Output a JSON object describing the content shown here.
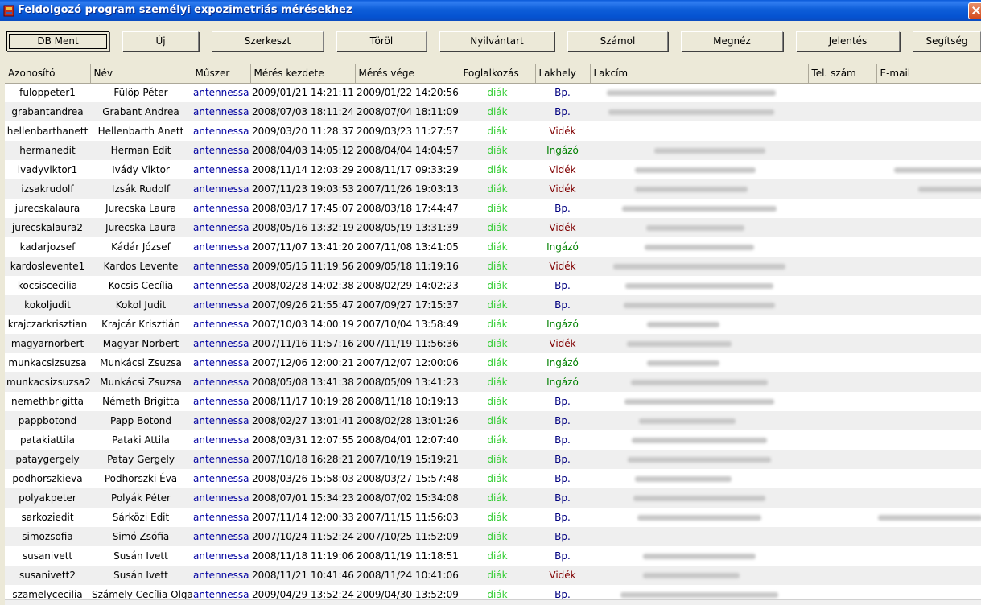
{
  "window": {
    "title": "Feldolgozó program személyi expozimetriás mérésekhez"
  },
  "toolbar": {
    "buttons": [
      "DB Ment",
      "Új",
      "Szerkeszt",
      "Töröl",
      "Nyilvántart",
      "Számol",
      "Megnéz",
      "Jelentés",
      "Segítség"
    ]
  },
  "table": {
    "headers": [
      "Azonosító",
      "Név",
      "Műszer",
      "Mérés kezdete",
      "Mérés vége",
      "Foglalkozás",
      "Lakhely",
      "Lakcím",
      "Tel. szám",
      "E-mail"
    ],
    "rows": [
      [
        "fuloppeter1",
        "Fülöp Péter",
        "antennessa",
        "2009/01/21 14:21:11",
        "2009/01/22 14:20:56",
        "diák",
        "Bp."
      ],
      [
        "grabantandrea",
        "Grabant Andrea",
        "antennessa",
        "2008/07/03 18:11:24",
        "2008/07/04 18:11:09",
        "diák",
        "Bp."
      ],
      [
        "hellenbarthanett",
        "Hellenbarth Anett",
        "antennessa",
        "2009/03/20 11:28:37",
        "2009/03/23 11:27:57",
        "diák",
        "Vidék"
      ],
      [
        "hermanedit",
        "Herman Edit",
        "antennessa",
        "2008/04/03 14:05:12",
        "2008/04/04 14:04:57",
        "diák",
        "Ingázó"
      ],
      [
        "ivadyviktor1",
        "Ivády Viktor",
        "antennessa",
        "2008/11/14 12:03:29",
        "2008/11/17 09:33:29",
        "diák",
        "Vidék"
      ],
      [
        "izsakrudolf",
        "Izsák Rudolf",
        "antennessa",
        "2007/11/23 19:03:53",
        "2007/11/26 19:03:13",
        "diák",
        "Vidék"
      ],
      [
        "jurecskalaura",
        "Jurecska Laura",
        "antennessa",
        "2008/03/17 17:45:07",
        "2008/03/18 17:44:47",
        "diák",
        "Bp."
      ],
      [
        "jurecskalaura2",
        "Jurecska Laura",
        "antennessa",
        "2008/05/16 13:32:19",
        "2008/05/19 13:31:39",
        "diák",
        "Vidék"
      ],
      [
        "kadarjozsef",
        "Kádár József",
        "antennessa",
        "2007/11/07 13:41:20",
        "2007/11/08 13:41:05",
        "diák",
        "Ingázó"
      ],
      [
        "kardoslevente1",
        "Kardos Levente",
        "antennessa",
        "2009/05/15 11:19:56",
        "2009/05/18 11:19:16",
        "diák",
        "Vidék"
      ],
      [
        "kocsiscecilia",
        "Kocsis Cecília",
        "antennessa",
        "2008/02/28 14:02:38",
        "2008/02/29 14:02:23",
        "diák",
        "Bp."
      ],
      [
        "kokoljudit",
        "Kokol Judit",
        "antennessa",
        "2007/09/26 21:55:47",
        "2007/09/27 17:15:37",
        "diák",
        "Bp."
      ],
      [
        "krajczarkrisztian",
        "Krajcár Krisztián",
        "antennessa",
        "2007/10/03 14:00:19",
        "2007/10/04 13:58:49",
        "diák",
        "Ingázó"
      ],
      [
        "magyarnorbert",
        "Magyar Norbert",
        "antennessa",
        "2007/11/16 11:57:16",
        "2007/11/19 11:56:36",
        "diák",
        "Vidék"
      ],
      [
        "munkacsizsuzsa",
        "Munkácsi Zsuzsa",
        "antennessa",
        "2007/12/06 12:00:21",
        "2007/12/07 12:00:06",
        "diák",
        "Ingázó"
      ],
      [
        "munkacsizsuzsa2",
        "Munkácsi Zsuzsa",
        "antennessa",
        "2008/05/08 13:41:38",
        "2008/05/09 13:41:23",
        "diák",
        "Ingázó"
      ],
      [
        "nemethbrigitta",
        "Németh Brigitta",
        "antennessa",
        "2008/11/17 10:19:28",
        "2008/11/18 10:19:13",
        "diák",
        "Bp."
      ],
      [
        "pappbotond",
        "Papp Botond",
        "antennessa",
        "2008/02/27 13:01:41",
        "2008/02/28 13:01:26",
        "diák",
        "Bp."
      ],
      [
        "patakiattila",
        "Pataki Attila",
        "antennessa",
        "2008/03/31 12:07:55",
        "2008/04/01 12:07:40",
        "diák",
        "Bp."
      ],
      [
        "pataygergely",
        "Patay Gergely",
        "antennessa",
        "2007/10/18 16:28:21",
        "2007/10/19 15:19:21",
        "diák",
        "Bp."
      ],
      [
        "podhorszkieva",
        "Podhorszki Éva",
        "antennessa",
        "2008/03/26 15:58:03",
        "2008/03/27 15:57:48",
        "diák",
        "Bp."
      ],
      [
        "polyakpeter",
        "Polyák Péter",
        "antennessa",
        "2008/07/01 15:34:23",
        "2008/07/02 15:34:08",
        "diák",
        "Bp."
      ],
      [
        "sarkoziedit",
        "Sárközi Edit",
        "antennessa",
        "2007/11/14 12:00:33",
        "2007/11/15 11:56:03",
        "diák",
        "Bp."
      ],
      [
        "simozsofia",
        "Simó Zsófia",
        "antennessa",
        "2007/10/24 11:52:24",
        "2007/10/25 11:52:09",
        "diák",
        "Bp."
      ],
      [
        "susanivett",
        "Susán Ivett",
        "antennessa",
        "2008/11/18 11:19:06",
        "2008/11/19 11:18:51",
        "diák",
        "Bp."
      ],
      [
        "susanivett2",
        "Susán Ivett",
        "antennessa",
        "2008/11/21 10:41:46",
        "2008/11/24 10:41:06",
        "diák",
        "Vidék"
      ],
      [
        "szamelycecilia",
        "Számely Cecília Olga",
        "antennessa",
        "2009/04/29 13:52:24",
        "2009/04/30 13:52:09",
        "diák",
        "Bp."
      ]
    ]
  },
  "colors": {
    "title_bar": "#0553d1",
    "muszer_text": "#0000a0",
    "foglalkozas_text": "#33cc33",
    "lakhely_bp": "#000080",
    "lakhely_videk": "#800000",
    "lakhely_ingazo": "#008000"
  }
}
